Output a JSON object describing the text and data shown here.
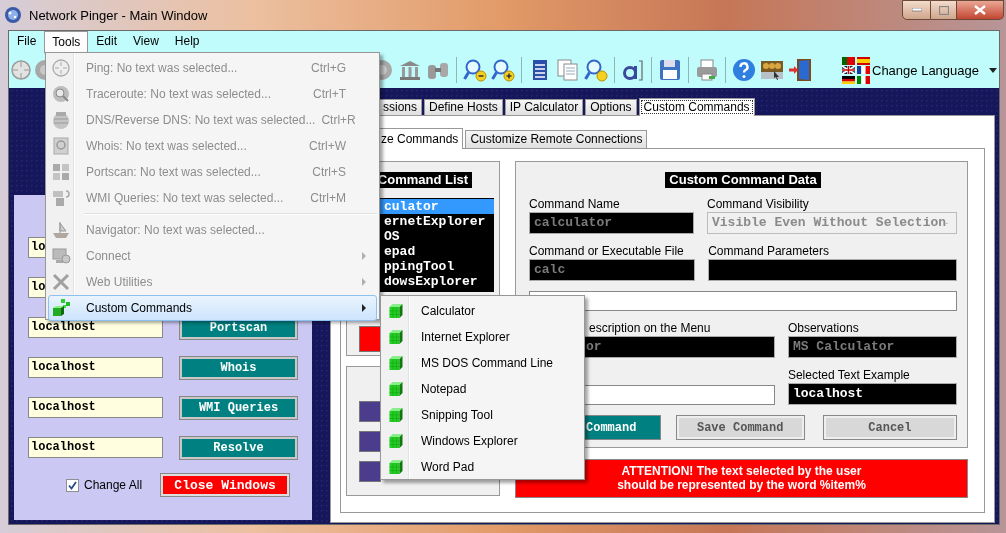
{
  "window": {
    "title": "Network Pinger - Main Window"
  },
  "menu_bar": [
    {
      "label": "File",
      "selected": false
    },
    {
      "label": "Tools",
      "selected": true
    },
    {
      "label": "Edit",
      "selected": false
    },
    {
      "label": "View",
      "selected": false
    },
    {
      "label": "Help",
      "selected": false
    }
  ],
  "toolbar": {
    "language_dropdown": "Change Language"
  },
  "tools_menu": [
    {
      "kind": "item",
      "label": "Ping: No text was selected...",
      "shortcut": "Ctrl+G",
      "disabled": true,
      "selected": false
    },
    {
      "kind": "item",
      "label": "Traceroute: No text was selected...",
      "shortcut": "Ctrl+T",
      "disabled": true,
      "selected": false
    },
    {
      "kind": "item",
      "label": "DNS/Reverse DNS: No text was selected...",
      "shortcut": "Ctrl+R",
      "disabled": true,
      "selected": false
    },
    {
      "kind": "item",
      "label": "Whois: No text was selected...",
      "shortcut": "Ctrl+W",
      "disabled": true,
      "selected": false
    },
    {
      "kind": "item",
      "label": "Portscan: No text was selected...",
      "shortcut": "Ctrl+S",
      "disabled": true,
      "selected": false
    },
    {
      "kind": "item",
      "label": "WMI Queries: No text was selected...",
      "shortcut": "Ctrl+M",
      "disabled": true,
      "selected": false
    },
    {
      "kind": "separator"
    },
    {
      "kind": "item",
      "label": "Navigator: No text was selected...",
      "disabled": true,
      "selected": false
    },
    {
      "kind": "submenu",
      "label": "Connect",
      "disabled": true,
      "selected": false
    },
    {
      "kind": "submenu",
      "label": "Web Utilities",
      "disabled": true,
      "selected": false
    },
    {
      "kind": "submenu",
      "label": "Custom Commands",
      "disabled": false,
      "selected": true
    }
  ],
  "custom_commands_submenu": [
    "Calculator",
    "Internet Explorer",
    "MS DOS Command Line",
    "Notepad",
    "Snipping Tool",
    "Windows Explorer",
    "Word Pad"
  ],
  "host_rows": [
    {
      "host": "lo"
    },
    {
      "host": "lo"
    },
    {
      "host": "localhost",
      "button": "Portscan"
    },
    {
      "host": "localhost",
      "button": "Whois"
    },
    {
      "host": "localhost",
      "button": "WMI Queries"
    },
    {
      "host": "localhost",
      "button": "Resolve"
    }
  ],
  "change_all": {
    "label": "Change All",
    "checked": true
  },
  "close_windows_button": "Close Windows",
  "tabs": [
    {
      "label": "ssions",
      "selected": false
    },
    {
      "label": "Define Hosts",
      "selected": false
    },
    {
      "label": "IP Calculator",
      "selected": false
    },
    {
      "label": "Options",
      "selected": false
    },
    {
      "label": "Custom Commands",
      "selected": true
    }
  ],
  "subtabs": [
    {
      "label": "ze Commands",
      "selected": true
    },
    {
      "label": "Customize Remote Connections",
      "selected": false
    }
  ],
  "command_list": {
    "title": "Command List",
    "items": [
      {
        "label": "culator",
        "selected": true
      },
      {
        "label": "ernetExplorer",
        "selected": false
      },
      {
        "label": "OS",
        "selected": false
      },
      {
        "label": "epad",
        "selected": false
      },
      {
        "label": "ppingTool",
        "selected": false
      },
      {
        "label": "dowsExplorer",
        "selected": false
      }
    ]
  },
  "command_data": {
    "title": "Custom Command Data",
    "rows": [
      [
        {
          "kind": "dark",
          "label": "Command Name",
          "value": "calculator",
          "disabled": true
        },
        {
          "kind": "dropdown",
          "label": "Command Visibility",
          "value": "Visible Even Without Selection",
          "disabled": true
        }
      ],
      [
        {
          "kind": "dark",
          "label": "Command or Executable File",
          "value": "calc",
          "disabled": true
        },
        {
          "kind": "dark",
          "label": "Command Parameters"
        }
      ],
      [
        {
          "kind": "light"
        }
      ],
      [
        {
          "kind": "dark",
          "label": "escription on the Menu",
          "value": "or",
          "disabled": true
        },
        {
          "kind": "dark",
          "label": "Observations",
          "value": "MS Calculator",
          "disabled": true
        }
      ],
      [
        {
          "kind": "light"
        },
        {
          "kind": "dark",
          "label": "Selected Text Example",
          "value": "localhost",
          "disabled": false
        }
      ]
    ],
    "buttons": [
      {
        "label": "Command",
        "kind": "primary"
      },
      {
        "label": "Save Command",
        "kind": "plain"
      },
      {
        "label": "Cancel",
        "kind": "plain"
      }
    ]
  },
  "attention": "ATTENTION! The text selected by the user should be represented by the word %item%"
}
